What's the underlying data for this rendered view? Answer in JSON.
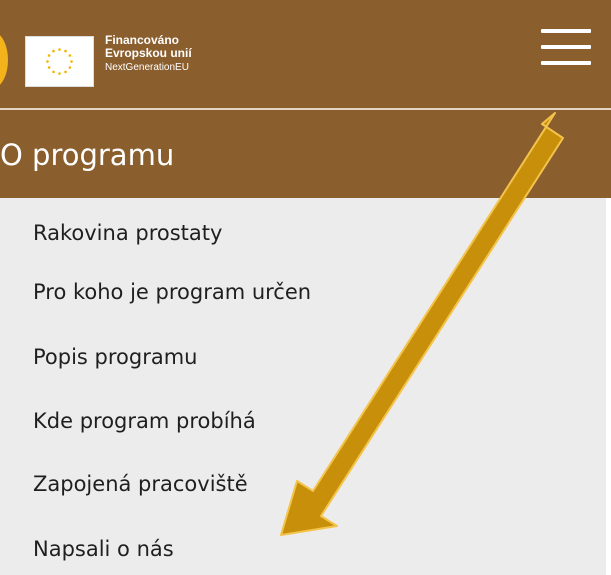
{
  "header": {
    "eu_line1": "Financováno",
    "eu_line2": "Evropskou unií",
    "eu_line3": "NextGenerationEU",
    "brand_color": "#8b5e2e"
  },
  "section": {
    "title": "O programu"
  },
  "menu": {
    "items": [
      "Rakovina prostaty",
      "Pro koho je program určen",
      "Popis programu",
      "Kde program probíhá",
      "Zapojená pracoviště",
      "Napsali o nás"
    ]
  },
  "annotation": {
    "arrow_color": "#c8900a",
    "icon": "arrow-down-left"
  }
}
